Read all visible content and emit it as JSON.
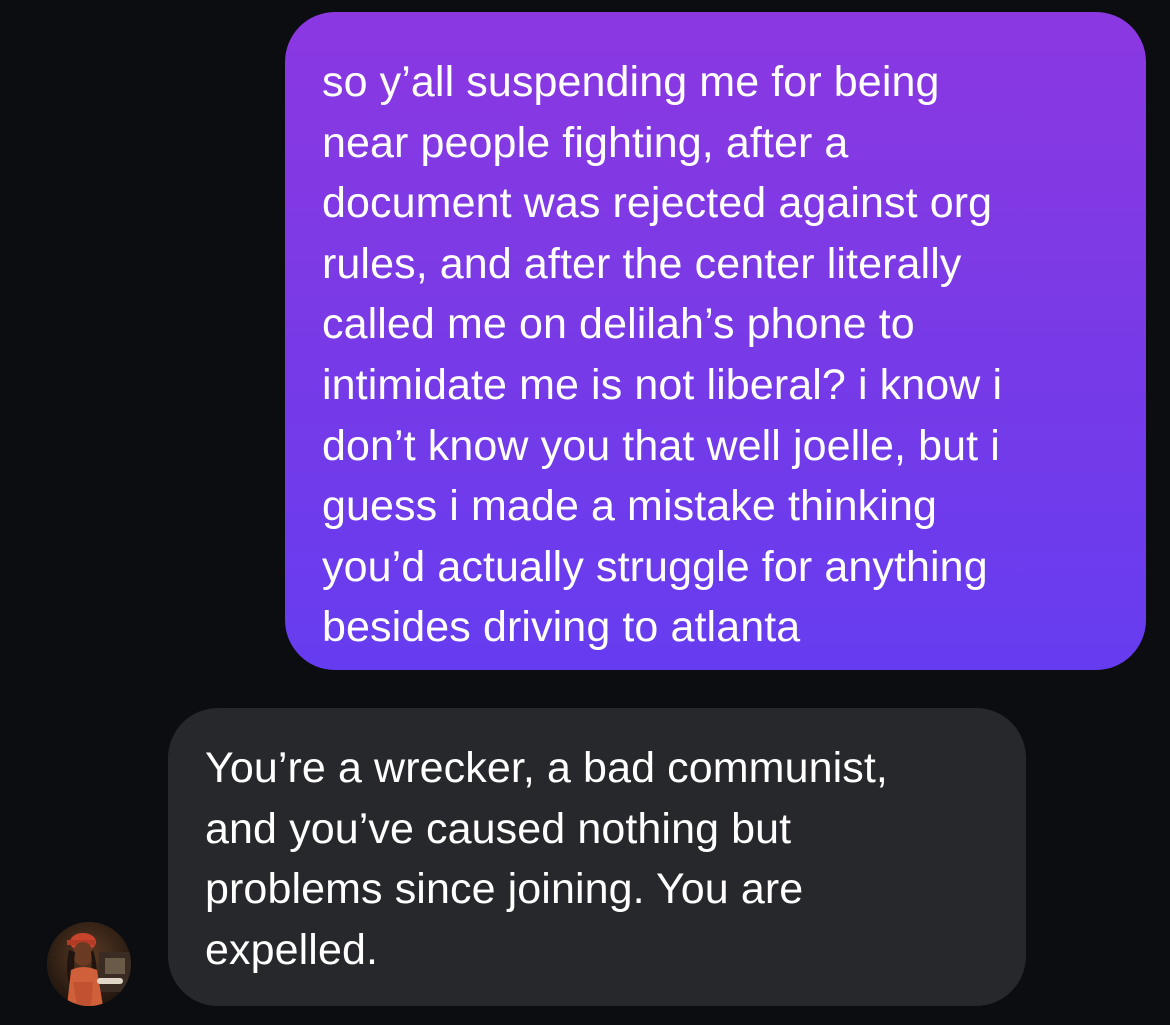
{
  "conversation": {
    "messages": [
      {
        "direction": "outgoing",
        "text": "so y’all suspending me for being\nnear people fighting, after a\ndocument was rejected against org\nrules, and after the center literally\ncalled me on delilah’s phone to\nintimidate me is not liberal? i know i\ndon’t know you that well joelle, but i\nguess i made a mistake thinking\nyou’d actually struggle for anything\nbesides driving to atlanta"
      },
      {
        "direction": "incoming",
        "text": "You’re a wrecker, a bad communist,\nand you’ve caused nothing but\nproblems since joining. You are\nexpelled."
      }
    ],
    "colors": {
      "background": "#0b0d11",
      "outgoing_gradient_top": "#8b38e1",
      "outgoing_gradient_bottom": "#663cf0",
      "incoming_bubble": "#26282c",
      "text": "#ffffff"
    },
    "sender_avatar_icon": "contact-avatar-photo"
  }
}
